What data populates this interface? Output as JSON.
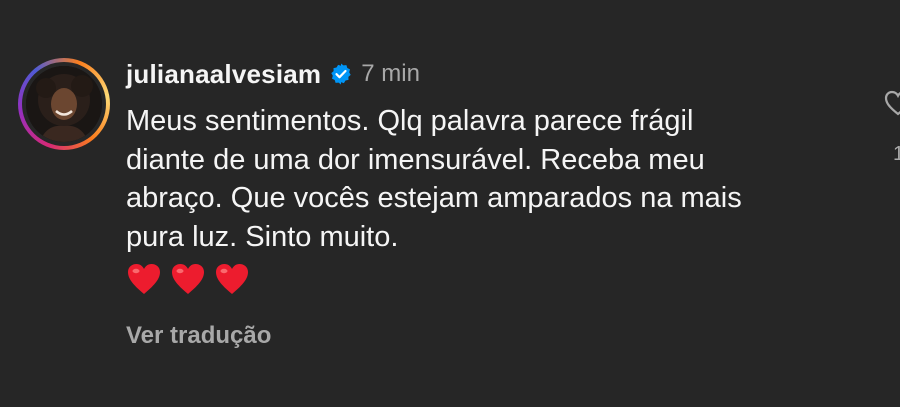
{
  "comment": {
    "username": "julianaalvesiam",
    "verified": true,
    "timestamp": "7 min",
    "text": "Meus sentimentos. Qlq palavra parece frágil\ndiante de uma dor imensurável. Receba meu\nabraço. Que vocês estejam amparados na mais\npura luz. Sinto muito.",
    "emoji": [
      "❤️",
      "❤️",
      "❤️"
    ],
    "translate_label": "Ver tradução",
    "like_count": "1"
  },
  "colors": {
    "background": "#262626",
    "primary_text": "#f5f5f5",
    "secondary_text": "#a8a8a8",
    "verified_badge": "#0095f6",
    "heart": "#ed1c2e"
  },
  "icons": {
    "verified": "verified-badge-icon",
    "like": "heart-outline-icon"
  }
}
